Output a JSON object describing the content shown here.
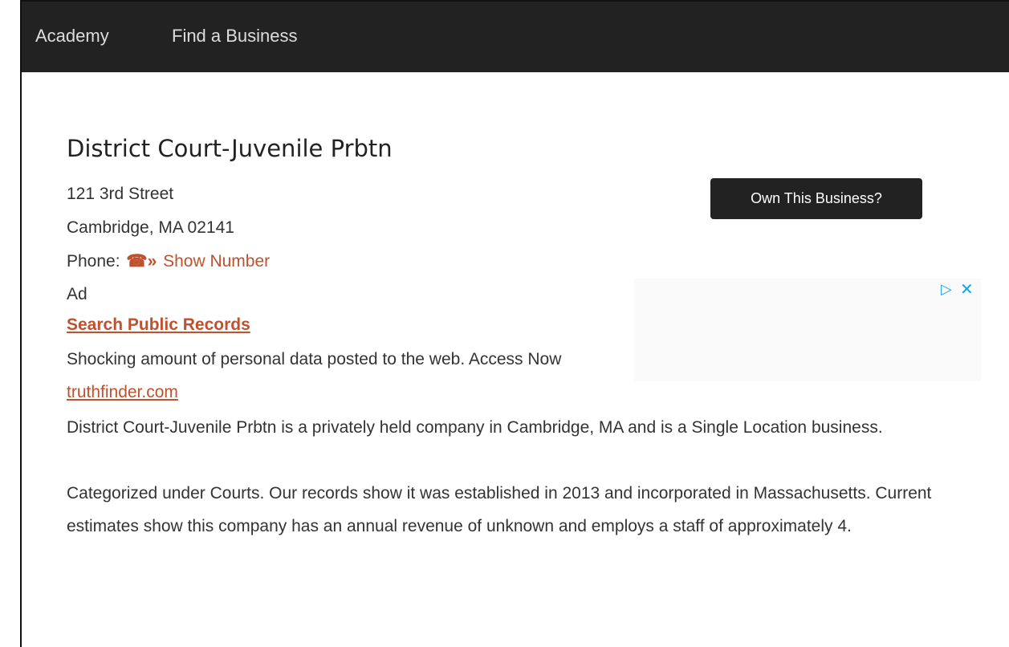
{
  "nav": {
    "items": [
      {
        "label": "Academy"
      },
      {
        "label": "Find a Business"
      }
    ]
  },
  "business": {
    "name": "District Court-Juvenile Prbtn",
    "address_line1": "121 3rd Street",
    "address_line2": "Cambridge, MA 02141",
    "phone_label": "Phone:",
    "phone_icon": "phone-hidden-icon",
    "phone_link": "Show Number",
    "own_button": "Own This Business?",
    "description1": "District Court-Juvenile Prbtn is a privately held company in Cambridge, MA and is a Single Location business.",
    "description2": "Categorized under Courts. Our records show it was established in 2013 and incorporated in Massachusetts. Current estimates show this company has an annual revenue of unknown and employs a staff of approximately 4."
  },
  "ad": {
    "label": "Ad",
    "title": "Search Public Records",
    "description": "Shocking amount of personal data posted to the web. Access Now",
    "url": "truthfinder.com",
    "adchoices_icon": "adchoices-icon",
    "close_icon": "close-icon"
  },
  "colors": {
    "navbar": "#222222",
    "accent": "#c0512f",
    "adchoices": "#1aa3e0"
  }
}
